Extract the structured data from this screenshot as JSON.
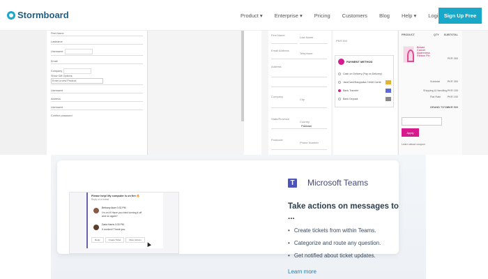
{
  "nav": {
    "logo": "Stormboard",
    "links": [
      "Product ▾",
      "Enterprise ▾",
      "Pricing",
      "Customers",
      "Blog",
      "Help ▾",
      "Login →"
    ],
    "signup": "Sign Up Free"
  },
  "left_form": {
    "rows": [
      "First Name",
      "Lastname",
      "Username",
      "Email",
      "Company",
      "Show Gift Options",
      "Enter a new Product",
      "Username",
      "Address",
      "Username",
      "Confirm password"
    ]
  },
  "right_form": {
    "left_fields": [
      "First Name",
      "Last Name",
      "Email Address",
      "Telephone",
      "Address",
      "Company",
      "City",
      "State/Province",
      "Country",
      "Postcode",
      "Phone Number"
    ],
    "country_value": "Pakistan",
    "payment_title": "PAYMENT METHOD",
    "payment_options": [
      "Cash on Delivery (Pay on Delivery)",
      "JazzCash/Easypaisa Credit Cards",
      "Bank Transfer",
      "Bank Deposit"
    ],
    "cart_header": [
      "PRODUCT",
      "QTY",
      "SUBTOTAL"
    ],
    "product_name": "Breast Cancer Awareness Ribbon Pin",
    "product_price": "PKR 350",
    "rows": [
      {
        "label": "Subtotal",
        "value": "PKR 350"
      },
      {
        "label": "Shipping & Handling",
        "value": "PKR 150"
      },
      {
        "label": "Flat Rate",
        "value": "PKR 150"
      },
      {
        "label": "GRAND TOTAL",
        "value": "PKR 500"
      }
    ],
    "apply": "Apply",
    "learn": "Learn about coupon"
  },
  "teams": {
    "brand": "Microsoft Teams",
    "heading": "Take actions on messages to ...",
    "bullets": [
      "Create tickets from within Teams.",
      "Categorize and route any question.",
      "Get notified about ticket updates."
    ],
    "learn_more": "Learn more",
    "chat_title": "Please help! My computer is on fire 🔥",
    "chat_sub": "Reply on a thread",
    "messages": [
      {
        "name": "Bethany Awer 3:32 PM",
        "text": "I'm on it! Have you tried turning it off and on again?"
      },
      {
        "name": "Daria Harris 3:33 PM",
        "text": "It worked! Thank you."
      }
    ],
    "actions": [
      "Reply",
      "Create Ticket",
      "More Actions"
    ]
  }
}
